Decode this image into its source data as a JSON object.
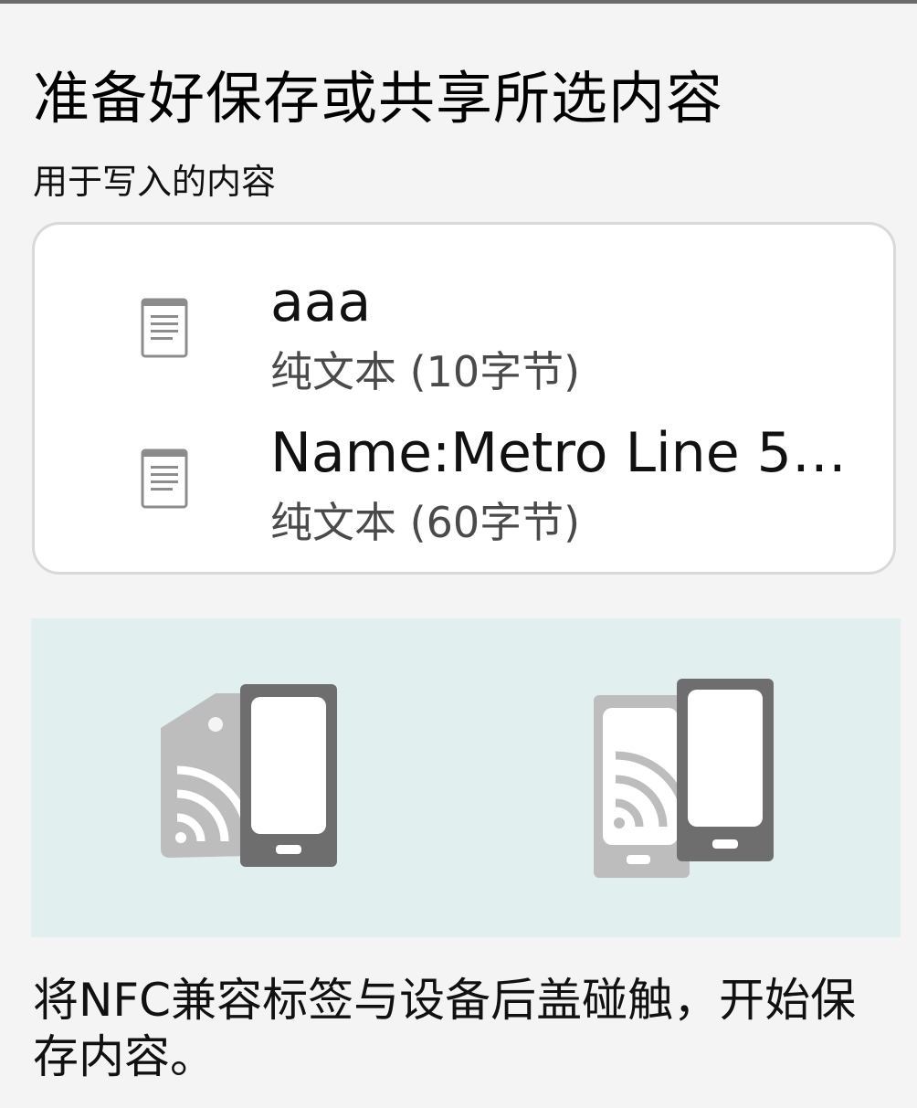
{
  "title": "准备好保存或共享所选内容",
  "subtitle": "用于写入的内容",
  "items": [
    {
      "icon": "document-icon",
      "name": "aaa",
      "meta": "纯文本 (10字节)"
    },
    {
      "icon": "document-icon",
      "name": "Name:Metro Line 5:...",
      "meta": "纯文本 (60字节)"
    }
  ],
  "illustrations": [
    {
      "icon": "nfc-tag-phone-icon"
    },
    {
      "icon": "phone-to-phone-icon"
    }
  ],
  "instructions": "将NFC兼容标签与设备后盖碰触，开始保存内容。",
  "colors": {
    "background": "#f4f4f4",
    "card": "#ffffff",
    "illustration_bg": "#e1f0ee",
    "device_dark": "#6e6e6e",
    "device_light": "#bdbdbd"
  }
}
